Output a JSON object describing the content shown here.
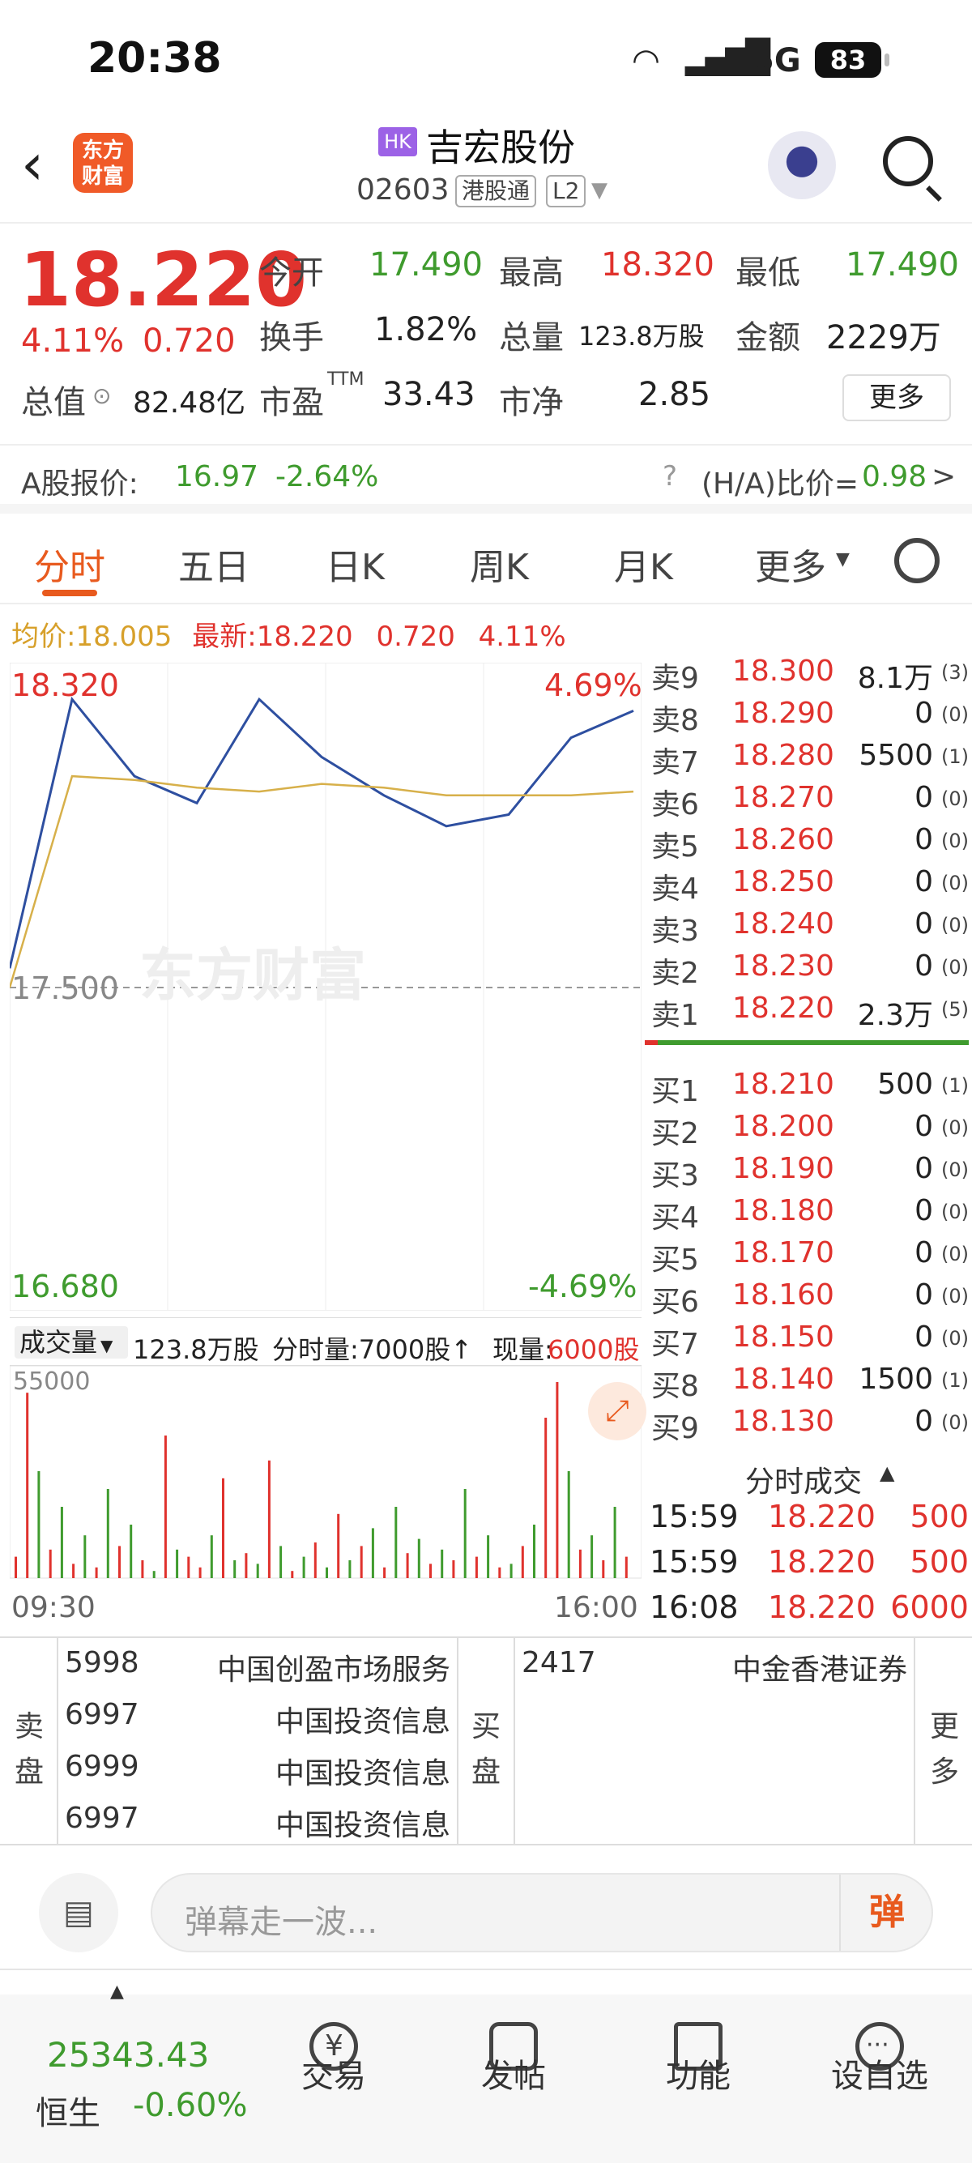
{
  "status_bar": {
    "time": "20:38",
    "network": "5G",
    "battery": "83"
  },
  "header": {
    "logo_text": "东方财富",
    "market_badge": "HK",
    "stock_name": "吉宏股份",
    "stock_code": "02603",
    "tag_connect": "港股通",
    "tag_level": "L2"
  },
  "quote": {
    "price": "18.220",
    "change_pct": "4.11%",
    "change": "0.720",
    "open_label": "今开",
    "open": "17.490",
    "high_label": "最高",
    "high": "18.320",
    "low_label": "最低",
    "low": "17.490",
    "turnover_label": "换手",
    "turnover": "1.82%",
    "volume_label": "总量",
    "volume": "123.8万股",
    "amount_label": "金额",
    "amount": "2229万",
    "mcap_label": "总值",
    "mcap": "82.48亿",
    "pe_label": "市盈",
    "pe_sup": "TTM",
    "pe": "33.43",
    "pb_label": "市净",
    "pb": "2.85",
    "more_label": "更多"
  },
  "a_share": {
    "label": "A股报价:",
    "price": "16.97",
    "change": "-2.64%",
    "ratio_label": "(H/A)比价=",
    "ratio": "0.98",
    "arrow": ">"
  },
  "tabs": {
    "items": [
      "分时",
      "五日",
      "日K",
      "周K",
      "月K",
      "更多"
    ],
    "active": "分时"
  },
  "chart_header": {
    "avg_label": "均价:",
    "avg": "18.005",
    "latest_label": "最新:",
    "latest": "18.220",
    "chg": "0.720",
    "pct": "4.11%"
  },
  "chart_data": [
    {
      "type": "line",
      "series": [
        {
          "name": "最新",
          "color": "#2e4fa0",
          "x": [
            "09:30",
            "10:00",
            "10:30",
            "11:00",
            "11:30",
            "13:30",
            "14:00",
            "14:30",
            "15:00",
            "15:30",
            "16:00"
          ],
          "values": [
            17.55,
            18.25,
            18.05,
            17.98,
            18.25,
            18.1,
            18.0,
            17.92,
            17.95,
            18.15,
            18.22
          ]
        },
        {
          "name": "均价",
          "color": "#d7b04a",
          "x": [
            "09:30",
            "10:00",
            "10:30",
            "11:00",
            "11:30",
            "13:30",
            "14:00",
            "14:30",
            "15:00",
            "15:30",
            "16:00"
          ],
          "values": [
            17.5,
            18.05,
            18.04,
            18.02,
            18.01,
            18.03,
            18.02,
            18.0,
            18.0,
            18.0,
            18.01
          ]
        }
      ],
      "ylim": [
        16.68,
        18.32
      ],
      "y_ticks_left": [
        "18.320",
        "17.500",
        "16.680"
      ],
      "y_ticks_right": [
        "4.69%",
        "-4.69%"
      ],
      "prev_close": 17.5
    },
    {
      "type": "bar",
      "title": "成交量",
      "total": "123.8万股",
      "minute_label": "分时量:7000股↑",
      "current_label": "现量:",
      "current": "6000股",
      "y_max_label": "55000",
      "x_labels": [
        "09:30",
        "16:00"
      ],
      "values": [
        6000,
        52000,
        30000,
        8000,
        20000,
        4000,
        12000,
        3000,
        25000,
        9000,
        15000,
        5000,
        2000,
        40000,
        8000,
        6000,
        3000,
        12000,
        28000,
        5000,
        7000,
        4000,
        33000,
        9000,
        2000,
        6000,
        10000,
        3000,
        18000,
        5000,
        9000,
        14000,
        3000,
        20000,
        7000,
        11000,
        4000,
        8000,
        5000,
        25000,
        6000,
        12000,
        3000,
        4000,
        9000,
        15000,
        45000,
        55000,
        30000,
        8000,
        12000,
        5000,
        20000,
        6000
      ],
      "colors": [
        "r",
        "r",
        "g",
        "r",
        "g",
        "r",
        "g",
        "r",
        "g",
        "r",
        "g",
        "r",
        "g",
        "r",
        "g",
        "r",
        "r",
        "g",
        "r",
        "g",
        "r",
        "g",
        "r",
        "g",
        "r",
        "g",
        "r",
        "g",
        "r",
        "g",
        "r",
        "g",
        "r",
        "g",
        "r",
        "g",
        "r",
        "g",
        "r",
        "g",
        "r",
        "g",
        "r",
        "g",
        "r",
        "g",
        "r",
        "r",
        "g",
        "r",
        "g",
        "r",
        "g",
        "r"
      ]
    }
  ],
  "order_book": {
    "asks": [
      {
        "label": "卖9",
        "price": "18.300",
        "vol": "8.1万",
        "cnt": "(3)"
      },
      {
        "label": "卖8",
        "price": "18.290",
        "vol": "0",
        "cnt": "(0)"
      },
      {
        "label": "卖7",
        "price": "18.280",
        "vol": "5500",
        "cnt": "(1)"
      },
      {
        "label": "卖6",
        "price": "18.270",
        "vol": "0",
        "cnt": "(0)"
      },
      {
        "label": "卖5",
        "price": "18.260",
        "vol": "0",
        "cnt": "(0)"
      },
      {
        "label": "卖4",
        "price": "18.250",
        "vol": "0",
        "cnt": "(0)"
      },
      {
        "label": "卖3",
        "price": "18.240",
        "vol": "0",
        "cnt": "(0)"
      },
      {
        "label": "卖2",
        "price": "18.230",
        "vol": "0",
        "cnt": "(0)"
      },
      {
        "label": "卖1",
        "price": "18.220",
        "vol": "2.3万",
        "cnt": "(5)"
      }
    ],
    "bids": [
      {
        "label": "买1",
        "price": "18.210",
        "vol": "500",
        "cnt": "(1)"
      },
      {
        "label": "买2",
        "price": "18.200",
        "vol": "0",
        "cnt": "(0)"
      },
      {
        "label": "买3",
        "price": "18.190",
        "vol": "0",
        "cnt": "(0)"
      },
      {
        "label": "买4",
        "price": "18.180",
        "vol": "0",
        "cnt": "(0)"
      },
      {
        "label": "买5",
        "price": "18.170",
        "vol": "0",
        "cnt": "(0)"
      },
      {
        "label": "买6",
        "price": "18.160",
        "vol": "0",
        "cnt": "(0)"
      },
      {
        "label": "买7",
        "price": "18.150",
        "vol": "0",
        "cnt": "(0)"
      },
      {
        "label": "买8",
        "price": "18.140",
        "vol": "1500",
        "cnt": "(1)"
      },
      {
        "label": "买9",
        "price": "18.130",
        "vol": "0",
        "cnt": "(0)"
      }
    ]
  },
  "ticks": {
    "title": "分时成交",
    "rows": [
      {
        "time": "15:59",
        "price": "18.220",
        "vol": "500"
      },
      {
        "time": "15:59",
        "price": "18.220",
        "vol": "500"
      },
      {
        "time": "16:08",
        "price": "18.220",
        "vol": "6000"
      }
    ]
  },
  "brokers": {
    "sell_label": "卖盘",
    "buy_label": "买盘",
    "more_label": "更多",
    "sell": [
      {
        "id": "5998",
        "name": "中国创盈市场服务"
      },
      {
        "id": "6997",
        "name": "中国投资信息"
      },
      {
        "id": "6999",
        "name": "中国投资信息"
      },
      {
        "id": "6997",
        "name": "中国投资信息"
      }
    ],
    "buy": [
      {
        "id": "2417",
        "name": "中金香港证券"
      }
    ]
  },
  "comment_bar": {
    "placeholder": "弹幕走一波...",
    "danmu_label": "弹"
  },
  "bottom_nav": {
    "index_value": "25343.43",
    "index_name": "恒生",
    "index_change": "-0.60%",
    "items": [
      "交易",
      "发帖",
      "功能",
      "设自选"
    ]
  },
  "watermark": "东方财富",
  "colors": {
    "up": "#e0322d",
    "down": "#3f9b2e",
    "accent": "#e85a1e",
    "price_line": "#2e4fa0",
    "avg_line": "#d7b04a"
  }
}
